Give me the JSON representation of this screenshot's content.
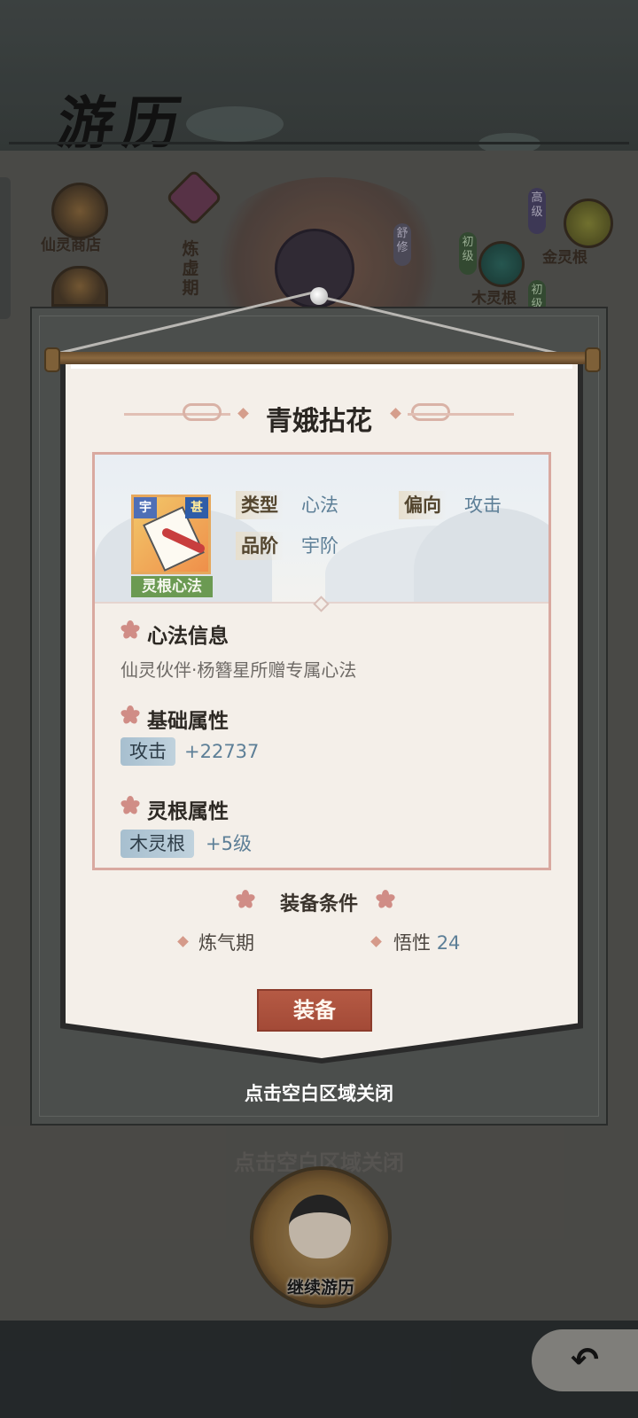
{
  "background": {
    "page_title": "游历",
    "shop_label": "仙灵商店",
    "realm_vertical": [
      "炼",
      "虚",
      "期"
    ],
    "badge_vertical": "舒修",
    "tags": {
      "high": "高级",
      "low": "初级",
      "low2": "初级"
    },
    "roots": {
      "gold": "金灵根",
      "wood": "木灵根"
    },
    "ghost_hint": "点击空白区域关闭",
    "continue_label": "继续游历",
    "back_icon": "back-arrow-icon"
  },
  "dialog": {
    "title": "青娥拈花",
    "icon": {
      "corner_left": "宇",
      "corner_right": "甚",
      "type_tag": "灵根心法"
    },
    "attributes": [
      {
        "key": "类型",
        "value": "心法"
      },
      {
        "key": "偏向",
        "value": "攻击"
      },
      {
        "key": "品阶",
        "value": "宇阶"
      }
    ],
    "info_section": {
      "title": "心法信息",
      "text": "仙灵伙伴·杨簪星所赠专属心法"
    },
    "base_section": {
      "title": "基础属性",
      "stat_label": "攻击",
      "stat_value": "+22737"
    },
    "root_section": {
      "title": "灵根属性",
      "stat_label": "木灵根",
      "stat_value": "+5级"
    },
    "requirements": {
      "title": "装备条件",
      "items": [
        {
          "label": "炼气期",
          "value": ""
        },
        {
          "label": "悟性",
          "value": "24"
        }
      ]
    },
    "equip_button": "装备",
    "close_hint": "点击空白区域关闭"
  },
  "colors": {
    "accent_red": "#a84e3a",
    "value_blue": "#5d7f97",
    "paper": "#f4efe9",
    "border_pink": "#d9a9a0"
  }
}
